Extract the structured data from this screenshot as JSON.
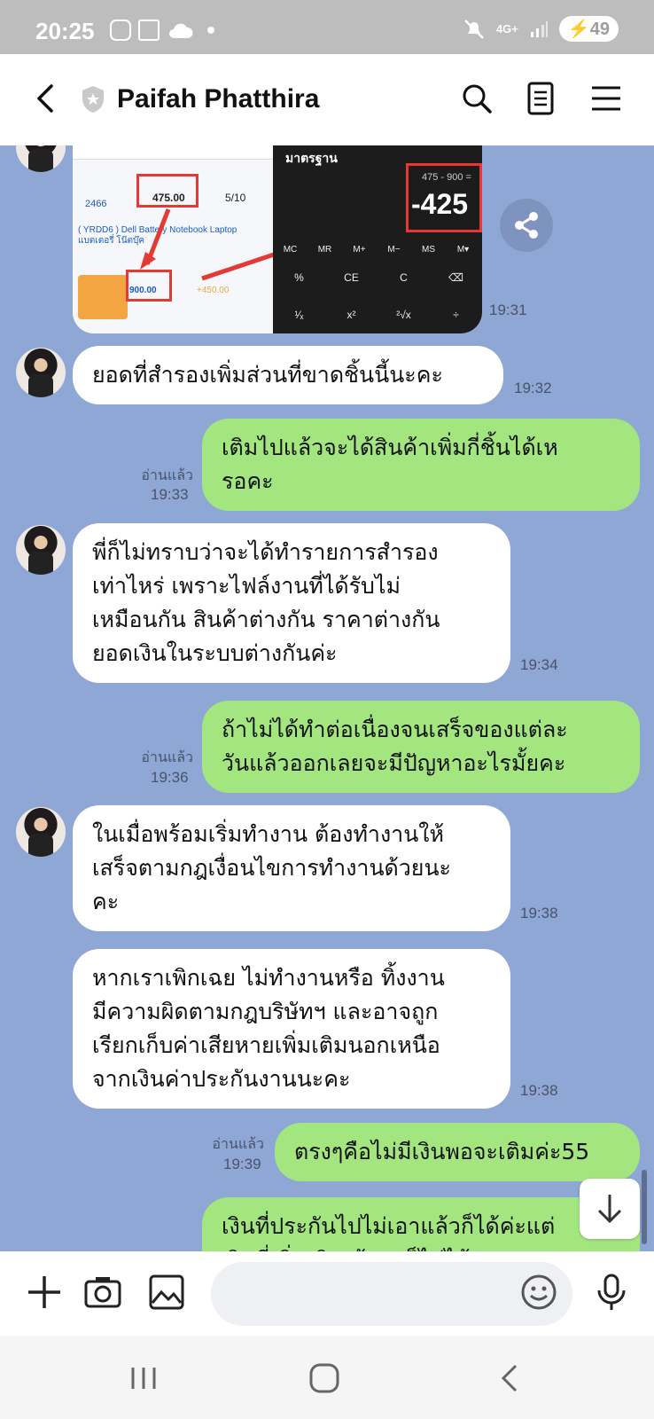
{
  "status_bar": {
    "time": "20:25",
    "network": "4G+",
    "battery": "49"
  },
  "header": {
    "title": "Paifah Phatthira"
  },
  "photo": {
    "calc_title": "มาตรฐาน",
    "calc_expression": "475 - 900 =",
    "calc_result": "-425",
    "calc_keys": [
      "%",
      "CE",
      "C",
      "⌫",
      "MC",
      "MR",
      "M+",
      "M−",
      "MS",
      "M▾",
      "¹⁄ₓ",
      "x²",
      "²√x",
      "÷"
    ],
    "left_amount": "475.00",
    "left_total": "2466",
    "left_count": "5/10",
    "left_product": "( YRDD6 ) Dell Battery Notebook Laptop แบตเตอรี่ โน๊ตบุ๊ค",
    "left_price": "900.00",
    "left_bonus": "+450.00",
    "time": "19:31"
  },
  "messages": [
    {
      "side": "in",
      "text": "ยอดที่สำรองเพิ่มส่วนที่ขาดชิ้นนี้นะคะ",
      "time": "19:32"
    },
    {
      "side": "out",
      "lines": [
        "เติมไปแล้วจะได้สินค้าเพิ่มกี่ชิ้นได้เห",
        "รอคะ"
      ],
      "read": "อ่านแล้ว",
      "time": "19:33"
    },
    {
      "side": "in",
      "lines": [
        "พี่ก็ไม่ทราบว่าจะได้ทำรายการสำรอง",
        "เท่าไหร่ เพราะไฟล์งานที่ได้รับไม่",
        "เหมือนกัน สินค้าต่างกัน ราคาต่างกัน",
        "ยอดเงินในระบบต่างกันค่ะ"
      ],
      "time": "19:34"
    },
    {
      "side": "out",
      "lines": [
        "ถ้าไม่ได้ทำต่อเนื่องจนเสร็จของแต่ละ",
        "วันแล้วออกเลยจะมีปัญหาอะไรมั้ยคะ"
      ],
      "read": "อ่านแล้ว",
      "time": "19:36"
    },
    {
      "side": "in",
      "lines": [
        "ในเมื่อพร้อมเริ่มทำงาน ต้องทำงานให้",
        "เสร็จตามกฎเงื่อนไขการทำงานด้วยนะ",
        "คะ"
      ],
      "time": "19:38"
    },
    {
      "side": "in",
      "lines": [
        "หากเราเพิกเฉย ไม่ทำงานหรือ ทิ้งงาน",
        "มีความผิดตามกฎบริษัทฯ และอาจถูก",
        "เรียกเก็บค่าเสียหายเพิ่มเติมนอกเหนือ",
        "จากเงินค่าประกันงานนะคะ"
      ],
      "time": "19:38"
    },
    {
      "side": "out",
      "text": "ตรงๆคือไม่มีเงินพอจะเติมค่ะ55",
      "read": "อ่านแล้ว",
      "time": "19:39"
    },
    {
      "side": "out",
      "lines": [
        "เงินที่ประกันไปไม่เอาแล้วก็ได้ค่ะแต่",
        "เงินที่เพิ่มเติมเข้ามาก็ไม่ได้เลย"
      ]
    }
  ],
  "input": {
    "placeholder": ""
  },
  "icons": {
    "back": "back-arrow-icon",
    "search": "search-icon",
    "notes": "notes-icon",
    "menu": "menu-icon",
    "share": "share-icon",
    "scroll_down": "arrow-down-icon",
    "add": "plus-icon",
    "camera": "camera-icon",
    "gallery": "image-icon",
    "emoji": "emoji-icon",
    "mic": "microphone-icon"
  },
  "colors": {
    "chat_bg": "#8ea7d4",
    "outgoing_bubble": "#a3e57f",
    "incoming_bubble": "#ffffff"
  }
}
